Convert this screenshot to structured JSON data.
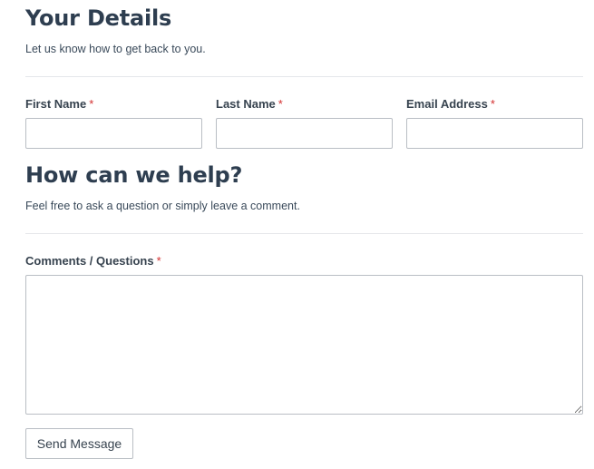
{
  "details_section": {
    "title": "Your Details",
    "subtitle": "Let us know how to get back to you."
  },
  "fields": {
    "first_name": {
      "label": "First Name",
      "required_marker": "*",
      "value": ""
    },
    "last_name": {
      "label": "Last Name",
      "required_marker": "*",
      "value": ""
    },
    "email": {
      "label": "Email Address",
      "required_marker": "*",
      "value": ""
    }
  },
  "help_section": {
    "title": "How can we help?",
    "subtitle": "Feel free to ask a question or simply leave a comment."
  },
  "comments": {
    "label": "Comments / Questions",
    "required_marker": "*",
    "value": ""
  },
  "submit": {
    "label": "Send Message"
  },
  "colors": {
    "heading": "#2e3e50",
    "required": "#d32f2f",
    "border": "#b9bec4",
    "divider": "#e5e7ea"
  }
}
